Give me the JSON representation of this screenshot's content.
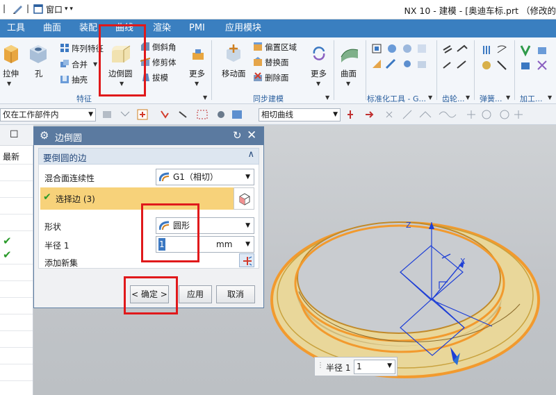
{
  "window": {
    "quick_access_window": "窗口",
    "title": "NX 10 - 建模 - [奥迪车标.prt （修改的"
  },
  "menu_tabs": [
    "工具",
    "曲面",
    "装配",
    "曲线",
    "渲染",
    "PMI",
    "应用模块"
  ],
  "ribbon": {
    "feature": {
      "extrude_label": "拉伸",
      "hole_label": "孔",
      "pattern_label": "阵列特征",
      "unite_label": "合并",
      "shell_label": "抽壳",
      "edge_blend_label": "边倒圆",
      "chamfer_label": "倒斜角",
      "trim_body_label": "修剪体",
      "draft_label": "拔模",
      "more_label": "更多",
      "group_label": "特征"
    },
    "sync": {
      "move_face_label": "移动面",
      "offset_region_label": "偏置区域",
      "replace_face_label": "替换面",
      "delete_face_label": "删除面",
      "more_label": "更多",
      "group_label": "同步建模"
    },
    "surface": {
      "surface_label": "曲面"
    },
    "groups": {
      "standard_tools": "标准化工具 - G...",
      "gear": "齿轮...",
      "spring": "弹簧...",
      "machining": "加工..."
    }
  },
  "selection_bar": {
    "scope_filter": "仅在工作部件内",
    "curve_rule": "相切曲线"
  },
  "navigator": {
    "column_header": "最新"
  },
  "dialog": {
    "title": "边倒圆",
    "section_title": "要倒圆的边",
    "continuity_label": "混合面连续性",
    "continuity_value": "G1（相切）",
    "select_edge_label": "选择边 (3)",
    "shape_label": "形状",
    "shape_value": "圆形",
    "radius_label": "半径 1",
    "radius_value": "1",
    "radius_unit": "mm",
    "add_set_label": "添加新集",
    "ok_button": "< 确定 >",
    "apply_button": "应用",
    "cancel_button": "取消"
  },
  "viewport": {
    "axis_z": "Z",
    "axis_x": "X",
    "radius_field_label": "半径 1",
    "radius_field_value": "1"
  },
  "colors": {
    "menubar": "#3a7fc0",
    "dialog_header": "#5b7aa0",
    "selected_row": "#f7d27a",
    "annotation_red": "#e0191b",
    "ring_face": "#e9d79a",
    "ring_edge": "#f29a2e",
    "check_green": "#2a9a2a"
  },
  "icons": [
    "extrude-icon",
    "hole-icon",
    "edge-blend-icon",
    "move-face-icon",
    "surface-icon",
    "settings-icon",
    "reset-icon",
    "close-icon",
    "collapse-icon",
    "check-icon",
    "cube-icon",
    "add-set-icon"
  ]
}
